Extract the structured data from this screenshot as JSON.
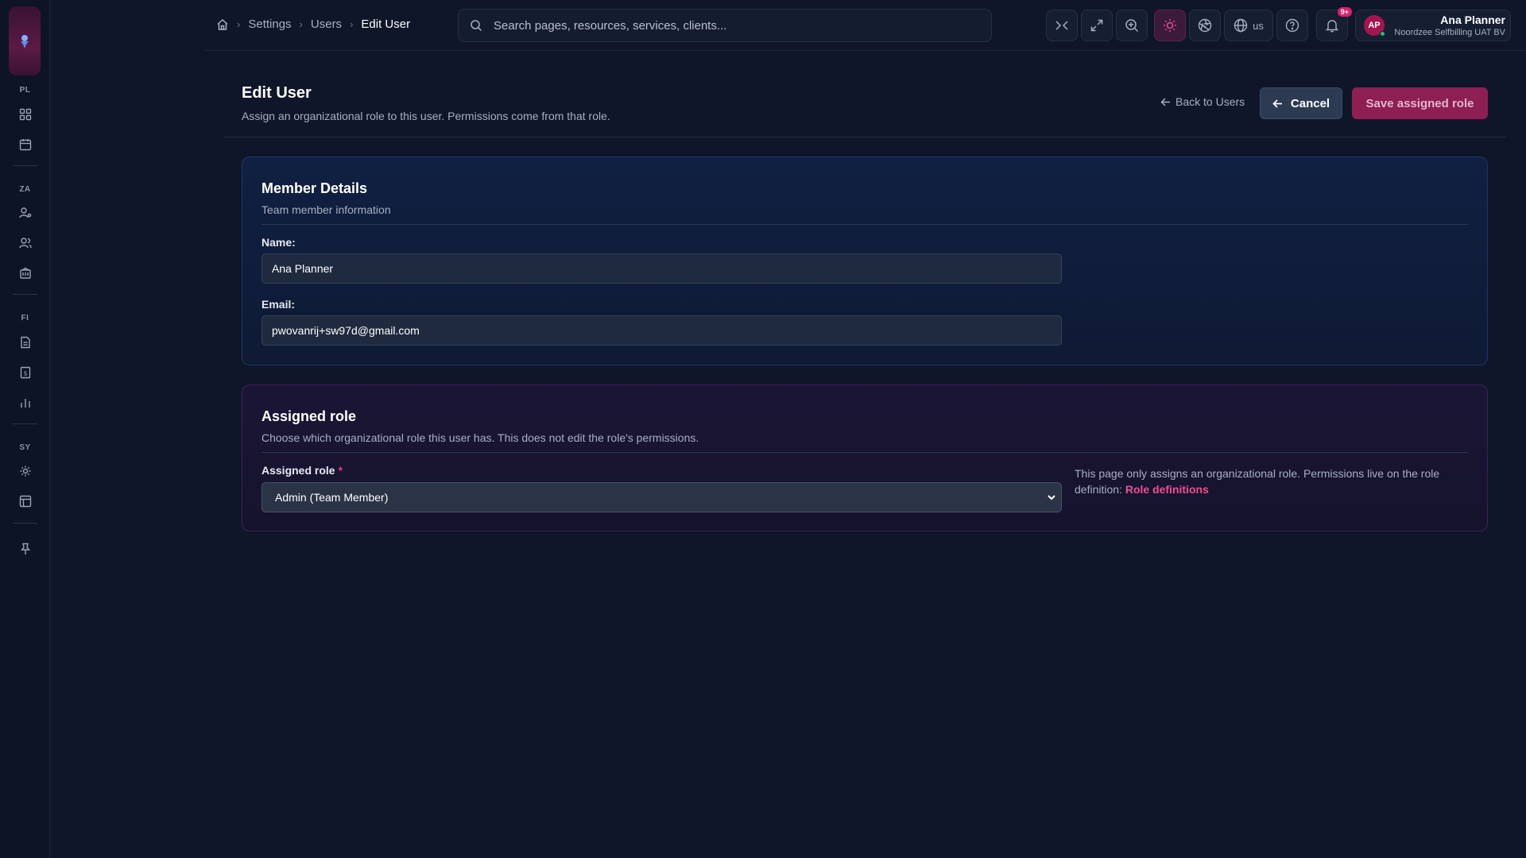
{
  "sidebar": {
    "sections": [
      {
        "label": "PL",
        "items": [
          {
            "icon": "grid-icon"
          },
          {
            "icon": "calendar-icon"
          }
        ]
      },
      {
        "label": "ZA",
        "items": [
          {
            "icon": "user-key-icon"
          },
          {
            "icon": "users-icon"
          },
          {
            "icon": "building-icon"
          }
        ]
      },
      {
        "label": "FI",
        "items": [
          {
            "icon": "document-icon"
          },
          {
            "icon": "receipt-icon"
          },
          {
            "icon": "bar-chart-icon"
          }
        ]
      },
      {
        "label": "SY",
        "items": [
          {
            "icon": "gear-icon"
          },
          {
            "icon": "template-icon"
          }
        ]
      }
    ],
    "bottom_icon": "pin-icon"
  },
  "breadcrumb": {
    "items": [
      "Settings",
      "Users"
    ],
    "current": "Edit User"
  },
  "search": {
    "placeholder": "Search pages, resources, services, clients..."
  },
  "toolbar": {
    "language": "us",
    "notification_badge": "9+"
  },
  "user": {
    "initials": "AP",
    "name": "Ana Planner",
    "org": "Noordzee Selfbilling UAT BV"
  },
  "page": {
    "title": "Edit User",
    "subtitle": "Assign an organizational role to this user. Permissions come from that role.",
    "back_label": "Back to Users",
    "cancel_label": "Cancel",
    "save_label": "Save assigned role"
  },
  "member": {
    "title": "Member Details",
    "subtitle": "Team member information",
    "name_label": "Name:",
    "name_value": "Ana Planner",
    "email_label": "Email:",
    "email_value": "pwovanrij+sw97d@gmail.com"
  },
  "role": {
    "title": "Assigned role",
    "subtitle": "Choose which organizational role this user has. This does not edit the role's permissions.",
    "field_label": "Assigned role",
    "required_mark": "*",
    "selected": "Admin (Team Member)",
    "note": "This page only assigns an organizational role. Permissions live on the role definition:",
    "note_link": "Role definitions"
  },
  "colors": {
    "background": "#0f1629",
    "accent": "#8e1f52",
    "link": "#ec4f94"
  }
}
